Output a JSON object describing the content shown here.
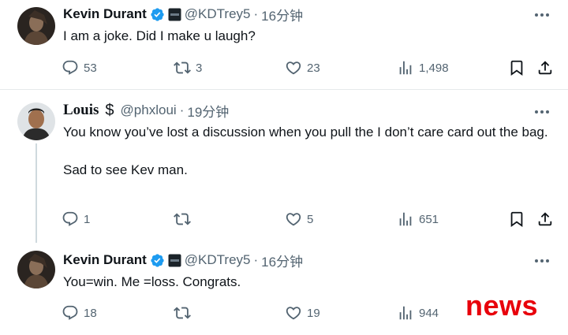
{
  "tweets": [
    {
      "name": "Kevin Durant",
      "handle": "@KDTrey5",
      "time": "16分钟",
      "text": "I am a joke. Did I make u laugh?",
      "replies": "53",
      "reposts": "3",
      "likes": "23",
      "views": "1,498"
    },
    {
      "name": "Louis",
      "handle": "@phxloui",
      "time": "19分钟",
      "text": "You know you’ve lost a discussion when you pull the I don’t care card out the bag.\n\nSad to see Kev man.",
      "replies": "1",
      "reposts": "",
      "likes": "5",
      "views": "651"
    },
    {
      "name": "Kevin Durant",
      "handle": "@KDTrey5",
      "time": "16分钟",
      "text": "You=win. Me =loss. Congrats.",
      "replies": "18",
      "reposts": "",
      "likes": "19",
      "views": "944"
    }
  ],
  "separator": "·",
  "dollar": "$",
  "watermark": "news",
  "colors": {
    "verified_blue": "#1d9bf0",
    "watermark_red": "#e8000b",
    "muted": "#536471"
  },
  "icons": [
    "verified-icon",
    "affiliate-badge-icon",
    "more-icon",
    "reply-icon",
    "repost-icon",
    "like-icon",
    "views-icon",
    "bookmark-icon",
    "share-icon"
  ]
}
